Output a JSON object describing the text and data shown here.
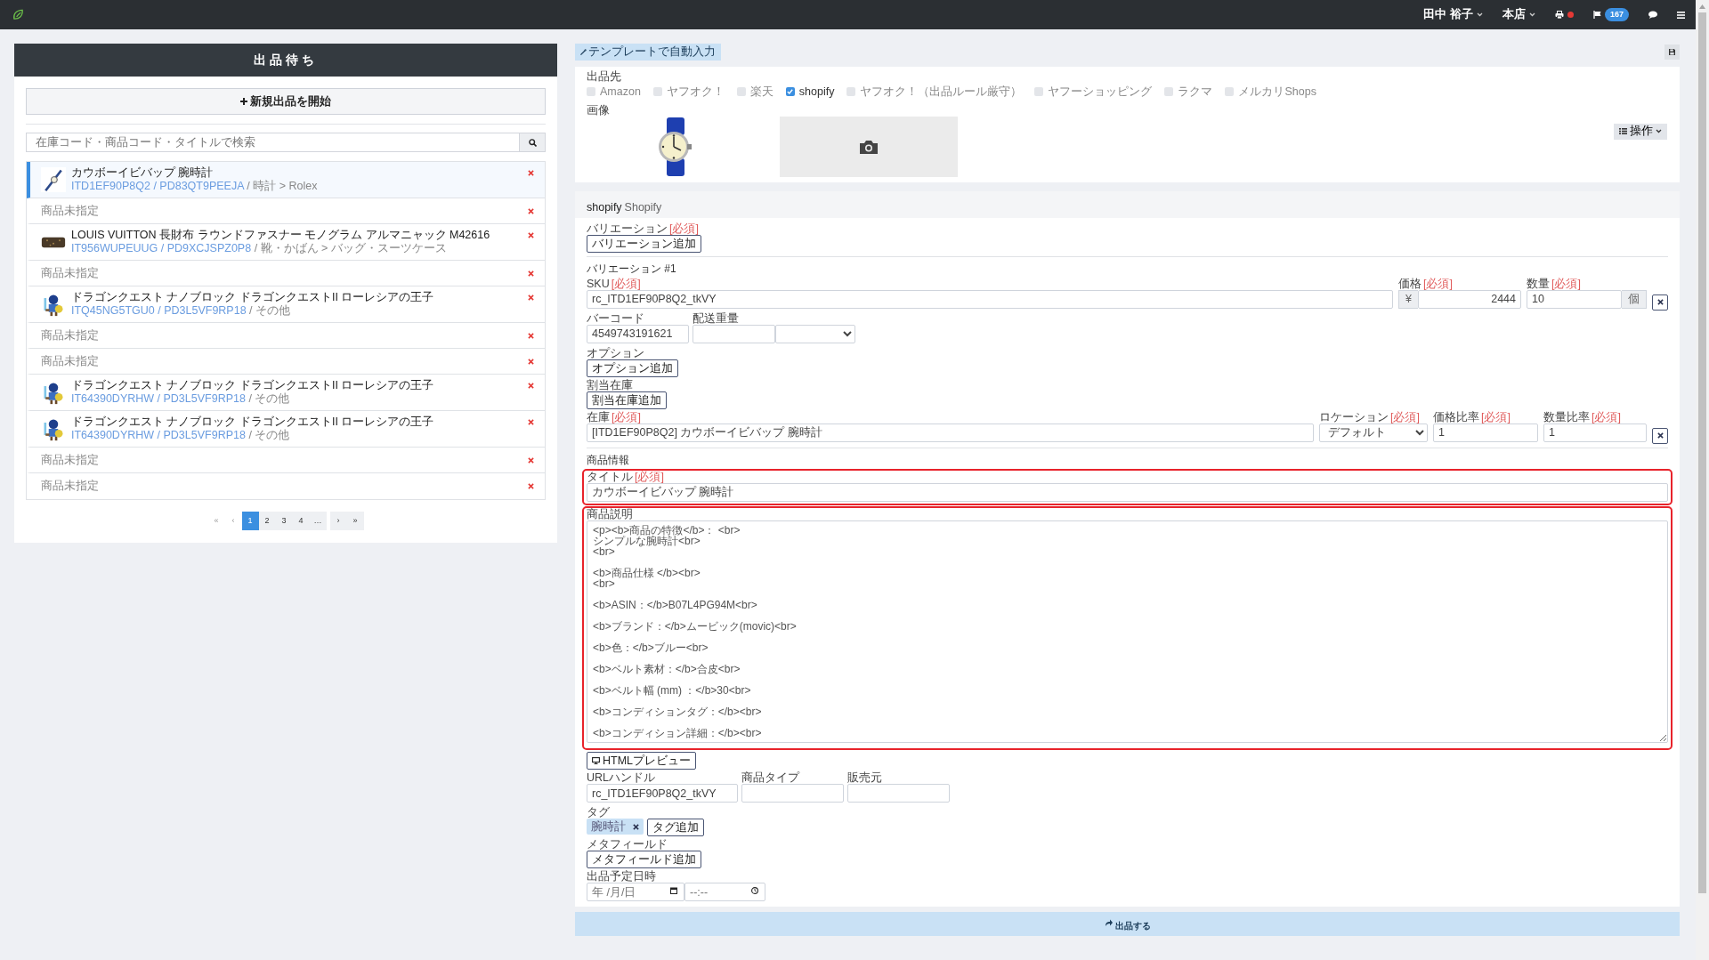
{
  "navbar": {
    "user": "田中 裕子",
    "store": "本店",
    "notification_count": "167"
  },
  "sidebar": {
    "title": "出品待ち",
    "new_button": "新規出品を開始",
    "search": {
      "placeholder": "在庫コード・商品コード・タイトルで検索"
    },
    "items": [
      {
        "kind": "product",
        "selected": true,
        "title": "カウボーイビバップ 腕時計",
        "codes": "ITD1EF90P8Q2 / PD83QT9PEEJA",
        "category": "/ 時計 > Rolex"
      },
      {
        "kind": "empty",
        "selected": false,
        "title": "商品未指定"
      },
      {
        "kind": "product",
        "selected": false,
        "title": "LOUIS VUITTON 長財布 ラウンドファスナー モノグラム アルマニャック M42616",
        "codes": "IT956WUPEUUG / PD9XCJSPZ0P8",
        "category": "/ 靴・かばん > バッグ・スーツケース"
      },
      {
        "kind": "empty",
        "selected": false,
        "title": "商品未指定"
      },
      {
        "kind": "product",
        "selected": false,
        "title": "ドラゴンクエスト ナノブロック ドラゴンクエストII ローレシアの王子",
        "codes": "ITQ45NG5TGU0 / PD3L5VF9RP18",
        "category": "/ その他"
      },
      {
        "kind": "empty",
        "selected": false,
        "title": "商品未指定"
      },
      {
        "kind": "empty",
        "selected": false,
        "title": "商品未指定"
      },
      {
        "kind": "product",
        "selected": false,
        "title": "ドラゴンクエスト ナノブロック ドラゴンクエストII ローレシアの王子",
        "codes": "IT64390DYRHW / PD3L5VF9RP18",
        "category": "/ その他"
      },
      {
        "kind": "product",
        "selected": false,
        "title": "ドラゴンクエスト ナノブロック ドラゴンクエストII ローレシアの王子",
        "codes": "IT64390DYRHW / PD3L5VF9RP18",
        "category": "/ その他"
      },
      {
        "kind": "empty",
        "selected": false,
        "title": "商品未指定"
      },
      {
        "kind": "empty",
        "selected": false,
        "title": "商品未指定"
      }
    ],
    "pagination": [
      {
        "label": "«",
        "selected": false
      },
      {
        "label": "‹",
        "selected": false
      },
      {
        "label": "1",
        "selected": true
      },
      {
        "label": "2",
        "selected": false
      },
      {
        "label": "3",
        "selected": false
      },
      {
        "label": "4",
        "selected": false
      },
      {
        "label": "…",
        "selected": false
      },
      {
        "label": "›",
        "selected": false
      },
      {
        "label": "»",
        "selected": false
      }
    ]
  },
  "toolbar": {
    "template_button": "テンプレートで自動入力"
  },
  "destinations": {
    "label": "出品先",
    "options": [
      {
        "label": "Amazon",
        "checked": false
      },
      {
        "label": "ヤフオク！",
        "checked": false
      },
      {
        "label": "楽天",
        "checked": false
      },
      {
        "label": "shopify",
        "checked": true
      },
      {
        "label": "ヤフオク！（出品ルール厳守）",
        "checked": false
      },
      {
        "label": "ヤフーショッピング",
        "checked": false
      },
      {
        "label": "ラクマ",
        "checked": false
      },
      {
        "label": "メルカリShops",
        "checked": false
      }
    ]
  },
  "images": {
    "label": "画像",
    "actions_button": "操作"
  },
  "shopify": {
    "title": "shopify",
    "subtitle": "Shopify",
    "variations_label": "バリエーション",
    "required_mark": "[必須]",
    "add_variation_button": "バリエーション追加",
    "variation": {
      "heading": "バリエーション #1",
      "sku": {
        "label": "SKU",
        "required_mark": "[必須]",
        "value": "rc_ITD1EF90P8Q2_tkVY"
      },
      "price": {
        "label": "価格",
        "required_mark": "[必須]",
        "currency": "¥",
        "value": "2444"
      },
      "quantity": {
        "label": "数量",
        "required_mark": "[必須]",
        "value": "10",
        "unit": "個"
      },
      "barcode": {
        "label": "バーコード",
        "value": "4549743191621"
      },
      "shipping_weight": {
        "label": "配送重量"
      },
      "options_label": "オプション",
      "add_option_button": "オプション追加",
      "allocation_label": "割当在庫",
      "add_allocation_button": "割当在庫追加",
      "stock": {
        "label": "在庫",
        "required_mark": "[必須]",
        "value": "[ITD1EF90P8Q2] カウボーイビバップ 腕時計"
      },
      "location": {
        "label": "ロケーション",
        "required_mark": "[必須]",
        "value": "デフォルト"
      },
      "price_ratio": {
        "label": "価格比率",
        "required_mark": "[必須]",
        "value": "1"
      },
      "quantity_ratio": {
        "label": "数量比率",
        "required_mark": "[必須]",
        "value": "1"
      }
    },
    "product_info": {
      "heading": "商品情報",
      "title": {
        "label": "タイトル",
        "required_mark": "[必須]",
        "value": "カウボーイビバップ 腕時計",
        "highlighted": true
      },
      "description": {
        "label": "商品説明",
        "value": "<p><b>商品の特徴</b>： <br>\nシンプルな腕時計<br>\n<br>\n\n<b>商品仕様 </b><br>\n<br>\n\n<b>ASIN：</b>B07L4PG94M<br>\n\n<b>ブランド：</b>ムービック(movic)<br>\n\n<b>色：</b>ブルー<br>\n\n<b>ベルト素材：</b>合皮<br>\n\n<b>ベルト幅 (mm) ：</b>30<br>\n\n<b>コンディションタグ：</b><br>\n\n<b>コンディション詳細：</b><br>",
        "highlighted": true
      },
      "html_preview_button": "HTMLプレビュー",
      "url_handle": {
        "label": "URLハンドル",
        "value": "rc_ITD1EF90P8Q2_tkVY"
      },
      "product_type": {
        "label": "商品タイプ"
      },
      "vendor": {
        "label": "販売元"
      },
      "tags_label": "タグ",
      "tags": [
        "腕時計"
      ],
      "add_tag_button": "タグ追加",
      "metafields_label": "メタフィールド",
      "add_metafield_button": "メタフィールド追加",
      "schedule": {
        "label": "出品予定日時",
        "date_placeholder": "年 /月/日",
        "time_placeholder": "--:--"
      }
    }
  },
  "publish_button": "出品する"
}
